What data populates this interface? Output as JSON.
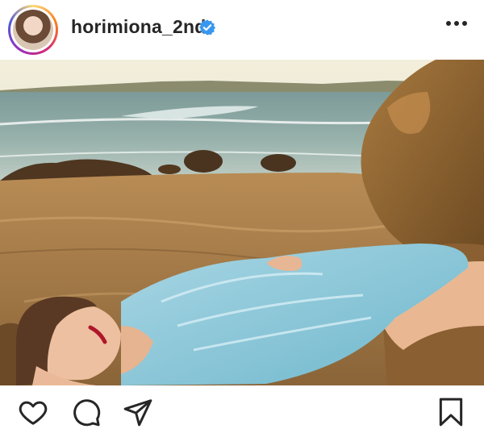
{
  "post": {
    "username": "horimiona_2nd",
    "verified": true,
    "icons": {
      "avatar": "profile-avatar",
      "verified": "verified-badge-icon",
      "more": "more-options-icon",
      "like": "heart-icon",
      "comment": "comment-icon",
      "share": "share-icon",
      "save": "bookmark-icon"
    }
  },
  "colors": {
    "text": "#262626",
    "verified_blue": "#3897f0",
    "divider": "#efefef"
  }
}
